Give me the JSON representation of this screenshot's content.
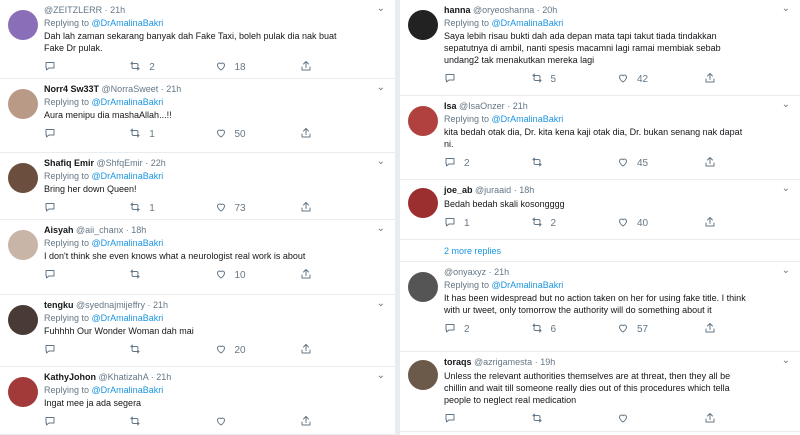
{
  "left": [
    {
      "name": "",
      "handle": "@ZEITZLERR",
      "time": "21h",
      "reply_to": "@DrAmalinaBakri",
      "text": "Dah lah zaman sekarang banyak dah Fake Taxi, boleh pulak dia nak buat\nFake Dr pulak.",
      "reply": "",
      "retweet": "2",
      "like": "18",
      "avatar": "#8a6fb8"
    },
    {
      "name": "Norr4 Sw33T",
      "handle": "@NorraSweet",
      "time": "21h",
      "reply_to": "@DrAmalinaBakri",
      "text": "Aura menipu dia mashaAllah...!!",
      "reply": "",
      "retweet": "1",
      "like": "50",
      "avatar": "#b99a86"
    },
    {
      "name": "Shafiq Emir",
      "handle": "@ShfqEmir",
      "time": "22h",
      "reply_to": "@DrAmalinaBakri",
      "text": "Bring her down Queen!",
      "reply": "",
      "retweet": "1",
      "like": "73",
      "avatar": "#6b4e3d"
    },
    {
      "name": "Aisyah",
      "handle": "@aii_chanx",
      "time": "18h",
      "reply_to": "@DrAmalinaBakri",
      "text": "I don't think she even knows what a neurologist real work is about",
      "reply": "",
      "retweet": "",
      "like": "10",
      "avatar": "#c9b4a8"
    },
    {
      "name": "tengku",
      "handle": "@syednajmijeffry",
      "time": "21h",
      "reply_to": "@DrAmalinaBakri",
      "text": "Fuhhhh Our Wonder Woman dah mai",
      "reply": "",
      "retweet": "",
      "like": "20",
      "avatar": "#4a3a36"
    },
    {
      "name": "KathyJohon",
      "handle": "@KhatizahA",
      "time": "21h",
      "reply_to": "@DrAmalinaBakri",
      "text": "Ingat mee ja ada segera",
      "reply": "",
      "retweet": "",
      "like": "",
      "avatar": "#a33a3a"
    }
  ],
  "right": [
    {
      "name": "hanna",
      "handle": "@oryeoshanna",
      "time": "20h",
      "reply_to": "@DrAmalinaBakri",
      "text": "Saya lebih risau bukti dah ada depan mata tapi takut tiada tindakkan\nsepatutnya di ambil, nanti spesis macamni lagi ramai membiak sebab\nundang2 tak menakutkan mereka lagi",
      "reply": "",
      "retweet": "5",
      "like": "42",
      "avatar": "#222222"
    },
    {
      "name": "Isa",
      "handle": "@IsaOnzer",
      "time": "21h",
      "reply_to": "@DrAmalinaBakri",
      "text": "kita bedah otak dia, Dr. kita kena kaji otak dia, Dr. bukan senang nak dapat\nni.",
      "reply": "2",
      "retweet": "",
      "like": "45",
      "avatar": "#b0413e"
    },
    {
      "name": "joe_ab",
      "handle": "@juraaid",
      "time": "18h",
      "reply_to": "",
      "text": "Bedah bedah skali kosongggg",
      "reply": "1",
      "retweet": "2",
      "like": "40",
      "avatar": "#9b2f2f"
    },
    {
      "name": "",
      "handle": "@onyaxyz",
      "time": "21h",
      "reply_to": "@DrAmalinaBakri",
      "text": "It has been widespread but no action taken on her for using fake title. I think\nwith ur tweet, only tomorrow the authority will do something about it",
      "reply": "2",
      "retweet": "6",
      "like": "57",
      "avatar": "#555555"
    },
    {
      "name": "toraqs",
      "handle": "@azrigamesta",
      "time": "19h",
      "reply_to": "",
      "text": "Unless the relevant authorities themselves are at threat, then they all be\nchillin and wait till someone really dies out of this procedures which tella\npeople to neglect real medication",
      "reply": "",
      "retweet": "",
      "like": "",
      "avatar": "#6b5a4a"
    }
  ],
  "more_replies_label": "2 more replies",
  "replying_prefix": "Replying to",
  "colors": {
    "accent": "#1b95e0",
    "muted": "#657786",
    "bg": "#e6ecf0"
  }
}
